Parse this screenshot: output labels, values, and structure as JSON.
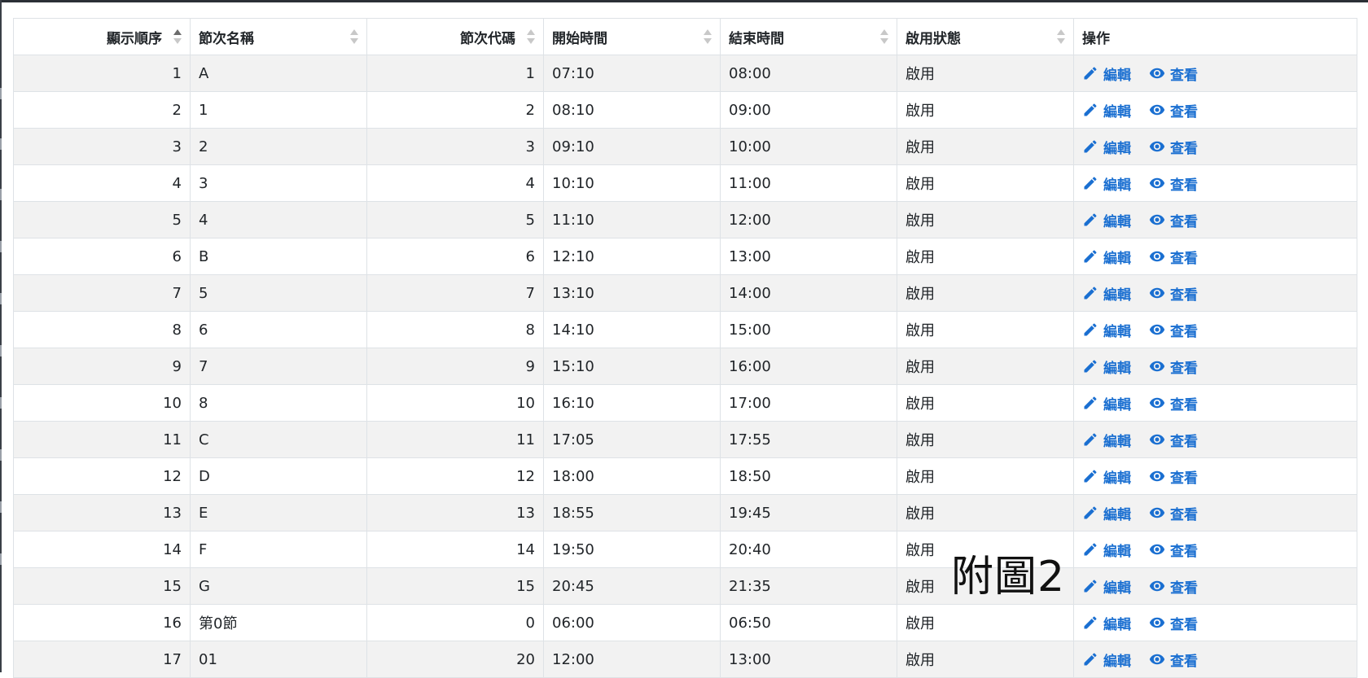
{
  "columns": [
    {
      "label": "顯示順序",
      "align": "num",
      "sort": "asc"
    },
    {
      "label": "節次名稱",
      "align": "txt",
      "sort": "none"
    },
    {
      "label": "節次代碼",
      "align": "num",
      "sort": "none"
    },
    {
      "label": "開始時間",
      "align": "txt",
      "sort": "none"
    },
    {
      "label": "結束時間",
      "align": "txt",
      "sort": "none"
    },
    {
      "label": "啟用狀態",
      "align": "txt",
      "sort": "none"
    },
    {
      "label": "操作",
      "align": "txt",
      "sort": "off"
    }
  ],
  "actions": {
    "edit_label": "編輯",
    "view_label": "查看",
    "edit_icon": "pencil-icon",
    "view_icon": "eye-icon",
    "color": "#1a6fd1"
  },
  "rows": [
    {
      "order": "1",
      "name": "A",
      "code": "1",
      "start": "07:10",
      "end": "08:00",
      "status": "啟用"
    },
    {
      "order": "2",
      "name": "1",
      "code": "2",
      "start": "08:10",
      "end": "09:00",
      "status": "啟用"
    },
    {
      "order": "3",
      "name": "2",
      "code": "3",
      "start": "09:10",
      "end": "10:00",
      "status": "啟用"
    },
    {
      "order": "4",
      "name": "3",
      "code": "4",
      "start": "10:10",
      "end": "11:00",
      "status": "啟用"
    },
    {
      "order": "5",
      "name": "4",
      "code": "5",
      "start": "11:10",
      "end": "12:00",
      "status": "啟用"
    },
    {
      "order": "6",
      "name": "B",
      "code": "6",
      "start": "12:10",
      "end": "13:00",
      "status": "啟用"
    },
    {
      "order": "7",
      "name": "5",
      "code": "7",
      "start": "13:10",
      "end": "14:00",
      "status": "啟用"
    },
    {
      "order": "8",
      "name": "6",
      "code": "8",
      "start": "14:10",
      "end": "15:00",
      "status": "啟用"
    },
    {
      "order": "9",
      "name": "7",
      "code": "9",
      "start": "15:10",
      "end": "16:00",
      "status": "啟用"
    },
    {
      "order": "10",
      "name": "8",
      "code": "10",
      "start": "16:10",
      "end": "17:00",
      "status": "啟用"
    },
    {
      "order": "11",
      "name": "C",
      "code": "11",
      "start": "17:05",
      "end": "17:55",
      "status": "啟用"
    },
    {
      "order": "12",
      "name": "D",
      "code": "12",
      "start": "18:00",
      "end": "18:50",
      "status": "啟用"
    },
    {
      "order": "13",
      "name": "E",
      "code": "13",
      "start": "18:55",
      "end": "19:45",
      "status": "啟用"
    },
    {
      "order": "14",
      "name": "F",
      "code": "14",
      "start": "19:50",
      "end": "20:40",
      "status": "啟用"
    },
    {
      "order": "15",
      "name": "G",
      "code": "15",
      "start": "20:45",
      "end": "21:35",
      "status": "啟用"
    },
    {
      "order": "16",
      "name": "第0節",
      "code": "0",
      "start": "06:00",
      "end": "06:50",
      "status": "啟用"
    },
    {
      "order": "17",
      "name": "01",
      "code": "20",
      "start": "12:00",
      "end": "13:00",
      "status": "啟用"
    }
  ],
  "watermark": "附圖2"
}
